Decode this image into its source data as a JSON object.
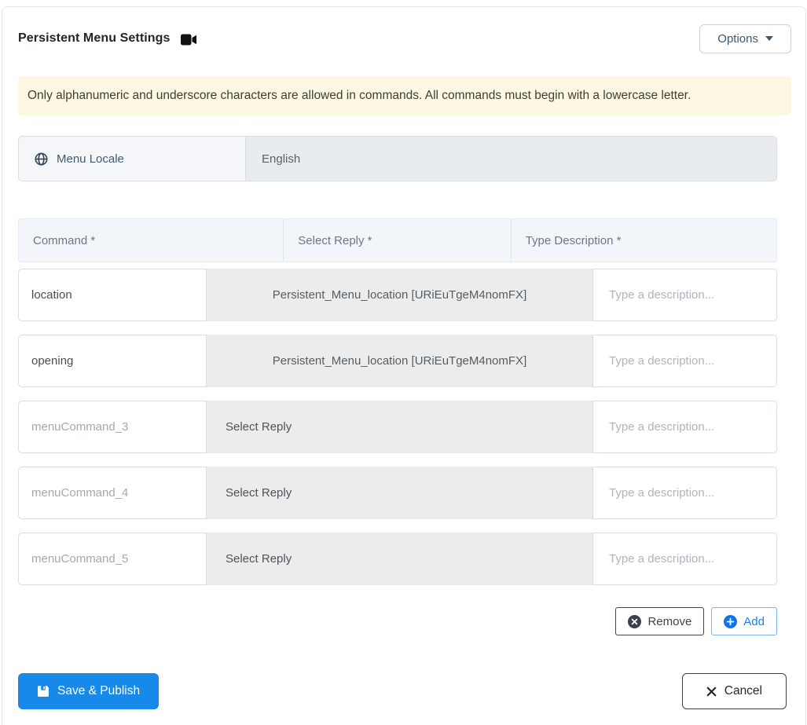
{
  "header": {
    "title": "Persistent Menu Settings",
    "title_icon": "video-camera-icon",
    "options_label": "Options"
  },
  "alert": {
    "text": "Only alphanumeric and underscore characters are allowed in commands. All commands must begin with a lowercase letter."
  },
  "locale": {
    "icon": "globe-icon",
    "label": "Menu Locale",
    "value": "English"
  },
  "table": {
    "headers": [
      "Command *",
      "Select Reply *",
      "Type Description *"
    ],
    "rows": [
      {
        "command": "location",
        "command_filled": true,
        "reply": "Persistent_Menu_location [URiEuTgeM4nomFX]",
        "reply_selected": true,
        "description_value": "",
        "description_placeholder": "Type a description..."
      },
      {
        "command": "opening",
        "command_filled": true,
        "reply": "Persistent_Menu_location [URiEuTgeM4nomFX]",
        "reply_selected": true,
        "description_value": "",
        "description_placeholder": "Type a description..."
      },
      {
        "command": "menuCommand_3",
        "command_filled": false,
        "reply": "Select Reply",
        "reply_selected": false,
        "description_value": "",
        "description_placeholder": "Type a description..."
      },
      {
        "command": "menuCommand_4",
        "command_filled": false,
        "reply": "Select Reply",
        "reply_selected": false,
        "description_value": "",
        "description_placeholder": "Type a description..."
      },
      {
        "command": "menuCommand_5",
        "command_filled": false,
        "reply": "Select Reply",
        "reply_selected": false,
        "description_value": "",
        "description_placeholder": "Type a description..."
      }
    ],
    "actions": {
      "remove_label": "Remove",
      "remove_icon": "x-circle-icon",
      "add_label": "Add",
      "add_icon": "plus-circle-icon"
    }
  },
  "footer": {
    "save_label": "Save & Publish",
    "save_icon": "floppy-save-icon",
    "cancel_label": "Cancel",
    "cancel_icon": "x-icon"
  },
  "colors": {
    "primary_blue": "#1789e8",
    "add_blue": "#1273e6",
    "add_border_blue": "#77b6f3",
    "dark_icon": "#3a4149",
    "alert_bg": "#fdf8e2",
    "table_header_bg": "#f2f6fa",
    "select_cell_bg": "#ececec",
    "locale_label_bg": "#f4f6f9",
    "disabled_input_bg": "#e9ecef",
    "title_text": "#212529",
    "muted_text": "#6d7780"
  }
}
